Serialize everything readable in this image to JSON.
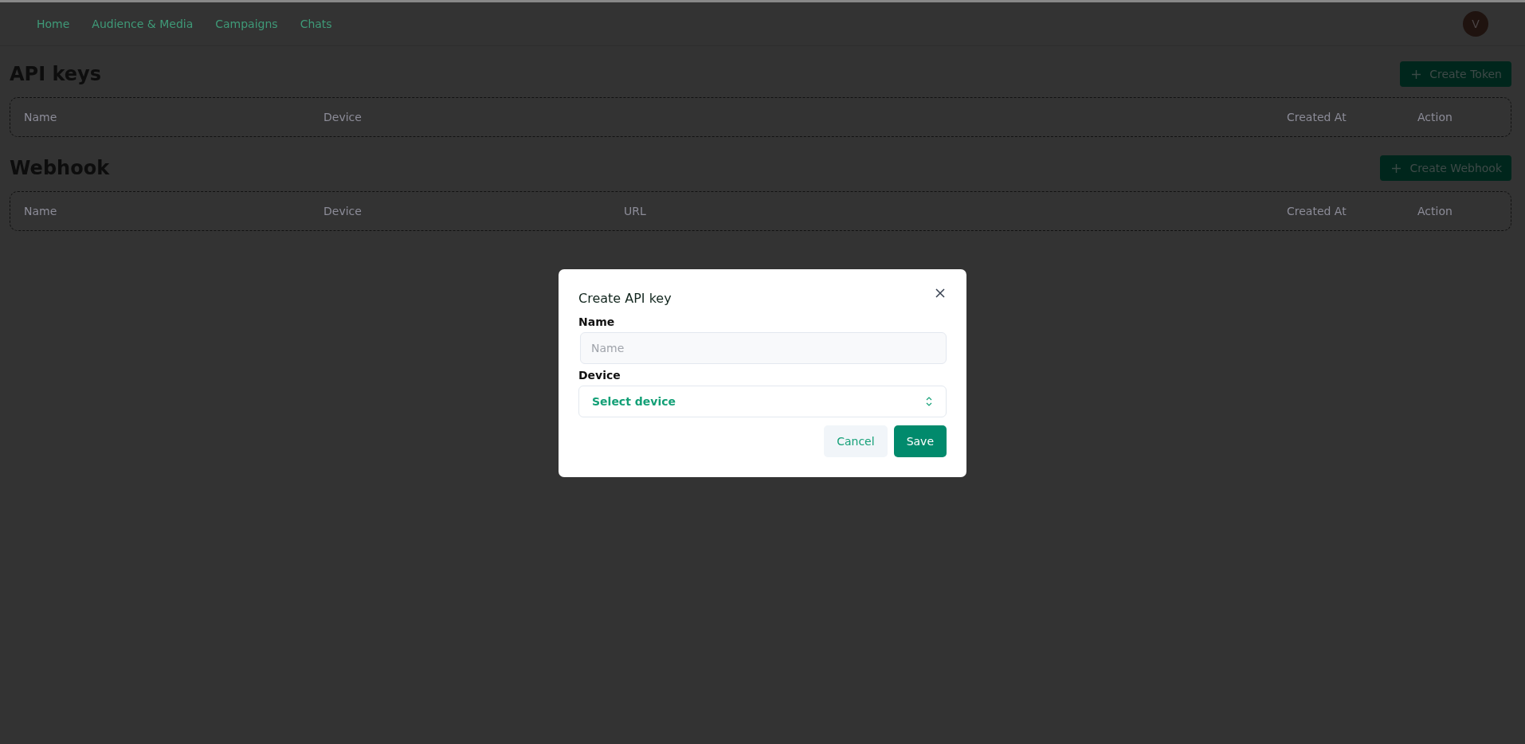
{
  "nav": {
    "items": [
      {
        "label": "Home"
      },
      {
        "label": "Audience & Media"
      },
      {
        "label": "Campaigns"
      },
      {
        "label": "Chats"
      }
    ],
    "avatar": "V"
  },
  "sections": [
    {
      "title": "API keys",
      "button": "Create Token",
      "columns": [
        "Name",
        "Device",
        "Created At",
        "Action"
      ]
    },
    {
      "title": "Webhook",
      "button": "Create Webhook",
      "columns": [
        "Name",
        "Device",
        "URL",
        "Created At",
        "Action"
      ]
    }
  ],
  "dialog": {
    "title": "Create API key",
    "fields": [
      {
        "kind": "text",
        "label": "Name",
        "placeholder": "Name"
      },
      {
        "kind": "select",
        "label": "Device",
        "value": "Select device"
      }
    ],
    "buttons": [
      {
        "kind": "secondary",
        "label": "Cancel"
      },
      {
        "kind": "primary",
        "label": "Save"
      }
    ]
  }
}
